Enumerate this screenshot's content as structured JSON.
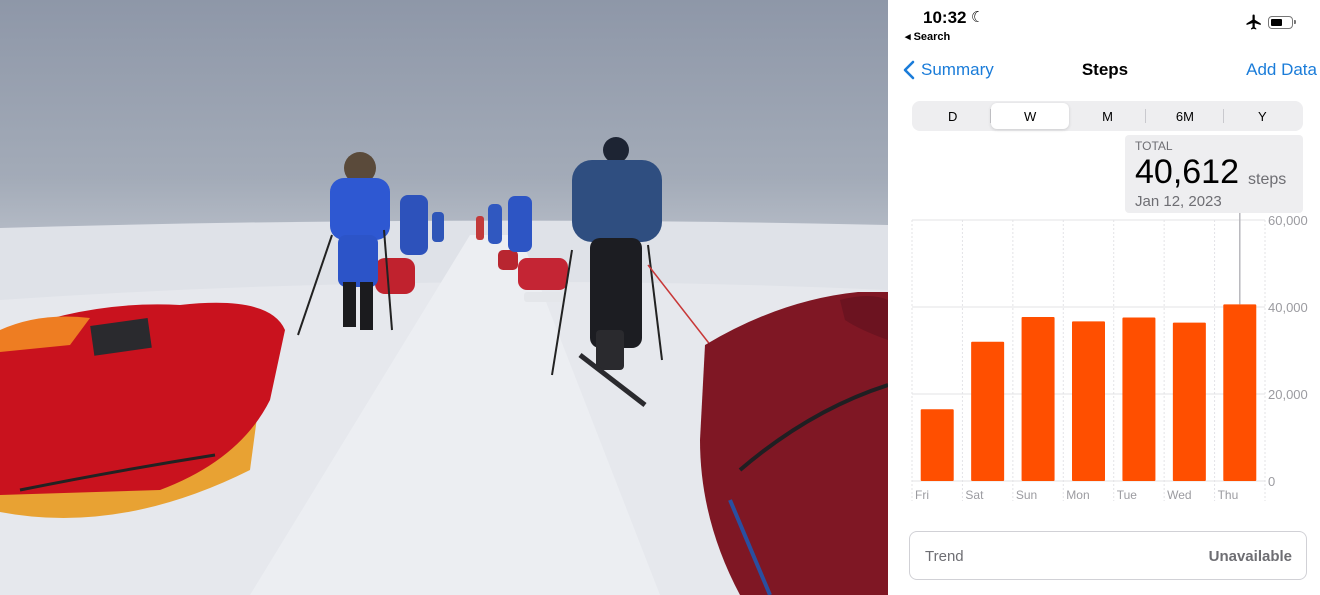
{
  "status_bar": {
    "time": "10:32",
    "back_app": "◂ Search"
  },
  "nav": {
    "back_label": "Summary",
    "title": "Steps",
    "action_label": "Add Data"
  },
  "segments": [
    "D",
    "W",
    "M",
    "6M",
    "Y"
  ],
  "selected_segment": "W",
  "total": {
    "label": "TOTAL",
    "value": "40,612",
    "unit": "steps",
    "date": "Jan 12, 2023"
  },
  "trend": {
    "label": "Trend",
    "value": "Unavailable"
  },
  "colors": {
    "accent": "#1a7cd9",
    "bar": "#ff4f00"
  },
  "chart_data": {
    "type": "bar",
    "categories": [
      "Fri",
      "Sat",
      "Sun",
      "Mon",
      "Tue",
      "Wed",
      "Thu"
    ],
    "values": [
      16500,
      32000,
      37700,
      36700,
      37600,
      36400,
      40612
    ],
    "ylim": [
      0,
      60000
    ],
    "yticks": [
      "60,000",
      "40,000",
      "20,000",
      "0"
    ],
    "grid": true,
    "selected_index": 6
  }
}
